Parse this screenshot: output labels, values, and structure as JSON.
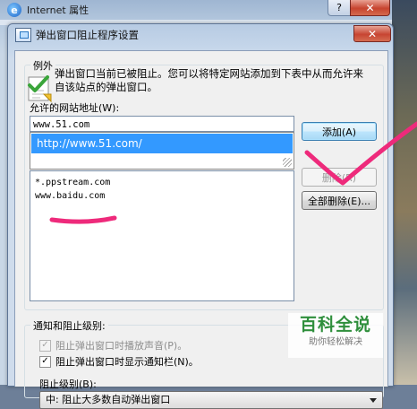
{
  "outer_window": {
    "title": "Internet 属性",
    "help_label": "?",
    "close_label": "✕"
  },
  "dialog": {
    "title": "弹出窗口阻止程序设置",
    "close_label": "✕"
  },
  "exceptions": {
    "group_label": "例外",
    "description": "弹出窗口当前已被阻止。您可以将特定网站添加到下表中从而允许来自该站点的弹出窗口。",
    "allowed_label": "允许的网站地址(W):",
    "address_value": "www.51.com",
    "suggestion": "http://www.51.com/",
    "sites": [
      "*.ppstream.com",
      "www.baidu.com"
    ],
    "add_button": "添加(A)",
    "remove_button": "删除(R)",
    "remove_all_button": "全部删除(E)..."
  },
  "notifications": {
    "group_label": "通知和阻止级别:",
    "play_sound_label": "阻止弹出窗口时播放声音(P)。",
    "show_bar_label": "阻止弹出窗口时显示通知栏(N)。",
    "level_label": "阻止级别(B):",
    "level_value": "中: 阻止大多数自动弹出窗口"
  },
  "watermark": {
    "title": "百科全说",
    "subtitle": "助你轻松解决"
  },
  "colors": {
    "annotation_pink": "#ee2a7b",
    "selection_blue": "#3399ff",
    "watermark_green": "#2f8f3c"
  }
}
